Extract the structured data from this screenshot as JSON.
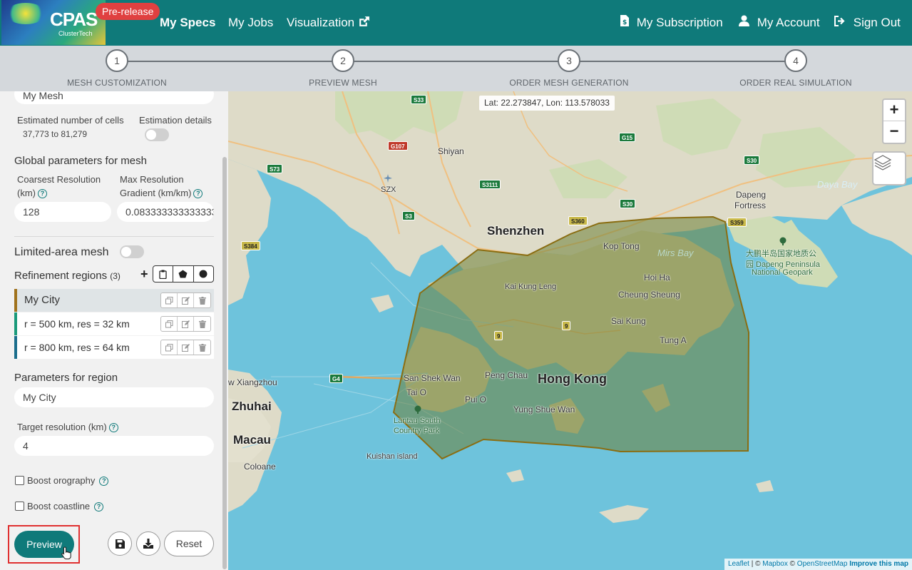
{
  "navbar": {
    "logo_text": "CPAS",
    "logo_sub": "ClusterTech",
    "badge": "Pre-release",
    "links": {
      "specs": "My Specs",
      "jobs": "My Jobs",
      "visualization": "Visualization",
      "subscription": "My Subscription",
      "account": "My Account",
      "signout": "Sign Out"
    },
    "color": "#0f7a7a"
  },
  "stepper": {
    "steps": [
      {
        "num": "1",
        "label": "MESH CUSTOMIZATION"
      },
      {
        "num": "2",
        "label": "PREVIEW MESH"
      },
      {
        "num": "3",
        "label": "ORDER MESH GENERATION"
      },
      {
        "num": "4",
        "label": "ORDER REAL SIMULATION"
      }
    ]
  },
  "sidebar": {
    "mesh_name": "My Mesh",
    "est_cells_label": "Estimated number of cells",
    "est_cells_value": "37,773 to 81,279",
    "est_details_label": "Estimation details",
    "global_title": "Global parameters for mesh",
    "coarsest_label_1": "Coarsest Resolution",
    "coarsest_label_2": "(km)",
    "coarsest_value": "128",
    "maxgrad_label_1": "Max Resolution",
    "maxgrad_label_2": "Gradient (km/km)",
    "maxgrad_value": "0.083333333333333",
    "limited_label": "Limited-area mesh",
    "refinement_label": "Refinement regions",
    "refinement_count": "(3)",
    "regions": [
      {
        "name": "My City",
        "color": "#a0721c"
      },
      {
        "name": "r = 500 km, res = 32 km",
        "color": "#1a9a7a"
      },
      {
        "name": "r = 800 km, res = 64 km",
        "color": "#1b6e8c"
      }
    ],
    "params_title": "Parameters for region",
    "region_name": "My City",
    "target_label": "Target resolution (km)",
    "target_value": "4",
    "boost_orography": "Boost orography",
    "boost_coastline": "Boost coastline",
    "preview_label": "Preview",
    "reset_label": "Reset"
  },
  "map": {
    "coords": "Lat: 22.273847, Lon: 113.578033",
    "zoom_in": "+",
    "zoom_out": "−",
    "labels": {
      "shenzhen": "Shenzhen",
      "hongkong": "Hong Kong",
      "zhuhai": "Zhuhai",
      "macau": "Macau",
      "shiyan": "Shiyan",
      "szx": "SZX",
      "kop_tong": "Kop Tong",
      "kai_kung_leng": "Kai Kung Leng",
      "hoi_ha": "Hoi Ha",
      "cheung_sheung": "Cheung Sheung",
      "sai_kung": "Sai Kung",
      "tung_a": "Tung A",
      "san_shek_wan": "San Shek Wan",
      "tai_o": "Tai O",
      "peng_chau": "Peng Chau",
      "pui_o": "Pui O",
      "yung_shue_wan": "Yung Shue Wan",
      "lantau": "Lantau South",
      "lantau2": "Country Park",
      "kuishan": "Kuishan island",
      "coloane": "Coloane",
      "xiangzhou": "w Xiangzhou",
      "dapeng": "Dapeng",
      "dapeng2": "Fortress",
      "daya_bay": "Daya Bay",
      "mirs_bay": "Mirs Bay",
      "dapeng_cn1": "大鹏半岛国家地质公",
      "dapeng_cn2": "园 Dapeng Peninsula",
      "dapeng_cn3": "National Geopark",
      "route_9a": "9",
      "route_9b": "9"
    },
    "shields": {
      "s33": "S33",
      "g107": "G107",
      "g15": "G15",
      "s30a": "S30",
      "s73": "S73",
      "s3111": "S3111",
      "s30b": "S30",
      "s3": "S3",
      "s360": "S360",
      "s359": "S359",
      "s384": "S384",
      "g4": "G4"
    },
    "attribution": {
      "leaflet": "Leaflet",
      "mapbox": "Mapbox",
      "osm": "OpenStreetMap",
      "improve": "Improve this map",
      "sep1": " | © ",
      "sep2": " © "
    },
    "polygon_color": "#7a6b18"
  }
}
